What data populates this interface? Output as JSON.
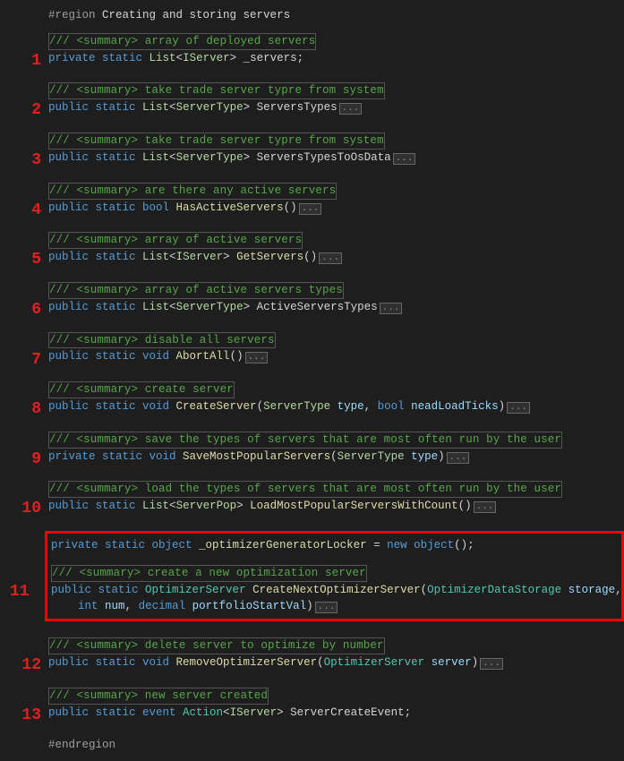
{
  "chart_data": null,
  "region": {
    "start": "#region",
    "title": "Creating and storing servers",
    "end": "#endregion"
  },
  "fold": "...",
  "items": [
    {
      "num": "1",
      "summary": "/// <summary> array of deployed servers",
      "code": [
        {
          "t": "private ",
          "c": "kw"
        },
        {
          "t": "static ",
          "c": "kw"
        },
        {
          "t": "List",
          "c": "type"
        },
        {
          "t": "<",
          "c": "punc"
        },
        {
          "t": "IServer",
          "c": "type"
        },
        {
          "t": "> ",
          "c": "punc"
        },
        {
          "t": "_servers",
          "c": "plain"
        },
        {
          "t": ";",
          "c": "punc"
        }
      ],
      "fold": false
    },
    {
      "num": "2",
      "summary": "/// <summary> take trade server typre from system",
      "code": [
        {
          "t": "public ",
          "c": "kw"
        },
        {
          "t": "static ",
          "c": "kw"
        },
        {
          "t": "List",
          "c": "type"
        },
        {
          "t": "<",
          "c": "punc"
        },
        {
          "t": "ServerType",
          "c": "type"
        },
        {
          "t": "> ",
          "c": "punc"
        },
        {
          "t": "ServersTypes",
          "c": "plain"
        }
      ],
      "fold": true
    },
    {
      "num": "3",
      "summary": "/// <summary> take trade server typre from system",
      "code": [
        {
          "t": "public ",
          "c": "kw"
        },
        {
          "t": "static ",
          "c": "kw"
        },
        {
          "t": "List",
          "c": "type"
        },
        {
          "t": "<",
          "c": "punc"
        },
        {
          "t": "ServerType",
          "c": "type"
        },
        {
          "t": "> ",
          "c": "punc"
        },
        {
          "t": "ServersTypesToOsData",
          "c": "plain"
        }
      ],
      "fold": true
    },
    {
      "num": "4",
      "summary": "/// <summary> are there any active servers",
      "code": [
        {
          "t": "public ",
          "c": "kw"
        },
        {
          "t": "static ",
          "c": "kw"
        },
        {
          "t": "bool ",
          "c": "kw"
        },
        {
          "t": "HasActiveServers",
          "c": "ident"
        },
        {
          "t": "()",
          "c": "punc"
        }
      ],
      "fold": true
    },
    {
      "num": "5",
      "summary": "/// <summary> array of active servers",
      "code": [
        {
          "t": "public ",
          "c": "kw"
        },
        {
          "t": "static ",
          "c": "kw"
        },
        {
          "t": "List",
          "c": "type"
        },
        {
          "t": "<",
          "c": "punc"
        },
        {
          "t": "IServer",
          "c": "type"
        },
        {
          "t": "> ",
          "c": "punc"
        },
        {
          "t": "GetServers",
          "c": "ident"
        },
        {
          "t": "()",
          "c": "punc"
        }
      ],
      "fold": true
    },
    {
      "num": "6",
      "summary": "/// <summary> array of active servers types",
      "code": [
        {
          "t": "public ",
          "c": "kw"
        },
        {
          "t": "static ",
          "c": "kw"
        },
        {
          "t": "List",
          "c": "type"
        },
        {
          "t": "<",
          "c": "punc"
        },
        {
          "t": "ServerType",
          "c": "type"
        },
        {
          "t": "> ",
          "c": "punc"
        },
        {
          "t": "ActiveServersTypes",
          "c": "plain"
        }
      ],
      "fold": true
    },
    {
      "num": "7",
      "summary": "/// <summary> disable all servers",
      "code": [
        {
          "t": "public ",
          "c": "kw"
        },
        {
          "t": "static ",
          "c": "kw"
        },
        {
          "t": "void ",
          "c": "kw"
        },
        {
          "t": "AbortAll",
          "c": "ident"
        },
        {
          "t": "()",
          "c": "punc"
        }
      ],
      "fold": true
    },
    {
      "num": "8",
      "summary": "/// <summary> create server",
      "code": [
        {
          "t": "public ",
          "c": "kw"
        },
        {
          "t": "static ",
          "c": "kw"
        },
        {
          "t": "void ",
          "c": "kw"
        },
        {
          "t": "CreateServer",
          "c": "ident"
        },
        {
          "t": "(",
          "c": "punc"
        },
        {
          "t": "ServerType ",
          "c": "type"
        },
        {
          "t": "type",
          "c": "param"
        },
        {
          "t": ", ",
          "c": "punc"
        },
        {
          "t": "bool ",
          "c": "kw"
        },
        {
          "t": "neadLoadTicks",
          "c": "param"
        },
        {
          "t": ")",
          "c": "punc"
        }
      ],
      "fold": true
    },
    {
      "num": "9",
      "summary": "/// <summary> save the types of servers that are most often run by the user",
      "code": [
        {
          "t": "private ",
          "c": "kw"
        },
        {
          "t": "static ",
          "c": "kw"
        },
        {
          "t": "void ",
          "c": "kw"
        },
        {
          "t": "SaveMostPopularServers",
          "c": "ident"
        },
        {
          "t": "(",
          "c": "punc"
        },
        {
          "t": "ServerType ",
          "c": "type"
        },
        {
          "t": "type",
          "c": "param"
        },
        {
          "t": ")",
          "c": "punc"
        }
      ],
      "fold": true
    },
    {
      "num": "10",
      "summary": "/// <summary> load the types of servers that are most often run by the user",
      "code": [
        {
          "t": "public ",
          "c": "kw"
        },
        {
          "t": "static ",
          "c": "kw"
        },
        {
          "t": "List",
          "c": "type"
        },
        {
          "t": "<",
          "c": "punc"
        },
        {
          "t": "ServerPop",
          "c": "type"
        },
        {
          "t": "> ",
          "c": "punc"
        },
        {
          "t": "LoadMostPopularServersWithCount",
          "c": "ident"
        },
        {
          "t": "()",
          "c": "punc"
        }
      ],
      "fold": true
    },
    {
      "num": "12",
      "summary": "/// <summary> delete server to optimize by number",
      "code": [
        {
          "t": "public ",
          "c": "kw"
        },
        {
          "t": "static ",
          "c": "kw"
        },
        {
          "t": "void ",
          "c": "kw"
        },
        {
          "t": "RemoveOptimizerServer",
          "c": "ident"
        },
        {
          "t": "(",
          "c": "punc"
        },
        {
          "t": "OptimizerServer ",
          "c": "typeY"
        },
        {
          "t": "server",
          "c": "param"
        },
        {
          "t": ")",
          "c": "punc"
        }
      ],
      "fold": true
    },
    {
      "num": "13",
      "summary": "/// <summary> new server created",
      "code": [
        {
          "t": "public ",
          "c": "kw"
        },
        {
          "t": "static ",
          "c": "kw"
        },
        {
          "t": "event ",
          "c": "kw"
        },
        {
          "t": "Action",
          "c": "typeY"
        },
        {
          "t": "<",
          "c": "punc"
        },
        {
          "t": "IServer",
          "c": "type"
        },
        {
          "t": "> ",
          "c": "punc"
        },
        {
          "t": "ServerCreateEvent",
          "c": "plain"
        },
        {
          "t": ";",
          "c": "punc"
        }
      ],
      "fold": false
    }
  ],
  "highlight": {
    "num": "11",
    "pre": [
      {
        "t": "private ",
        "c": "kw"
      },
      {
        "t": "static ",
        "c": "kw"
      },
      {
        "t": "object ",
        "c": "kw"
      },
      {
        "t": "_optimizerGeneratorLocker",
        "c": "ident"
      },
      {
        "t": " = ",
        "c": "punc"
      },
      {
        "t": "new ",
        "c": "kw"
      },
      {
        "t": "object",
        "c": "kw"
      },
      {
        "t": "();",
        "c": "punc"
      }
    ],
    "summary": "/// <summary> create a new optimization server",
    "line1": [
      {
        "t": "public ",
        "c": "kw"
      },
      {
        "t": "static ",
        "c": "kw"
      },
      {
        "t": "OptimizerServer ",
        "c": "typeY"
      },
      {
        "t": "CreateNextOptimizerServer",
        "c": "ident"
      },
      {
        "t": "(",
        "c": "punc"
      },
      {
        "t": "OptimizerDataStorage ",
        "c": "typeY"
      },
      {
        "t": "storage",
        "c": "param"
      },
      {
        "t": ",",
        "c": "punc"
      }
    ],
    "line2": [
      {
        "t": "    ",
        "c": "plain"
      },
      {
        "t": "int ",
        "c": "kw"
      },
      {
        "t": "num",
        "c": "param"
      },
      {
        "t": ", ",
        "c": "punc"
      },
      {
        "t": "decimal ",
        "c": "kw"
      },
      {
        "t": "portfolioStartVal",
        "c": "param"
      },
      {
        "t": ")",
        "c": "punc"
      }
    ]
  }
}
